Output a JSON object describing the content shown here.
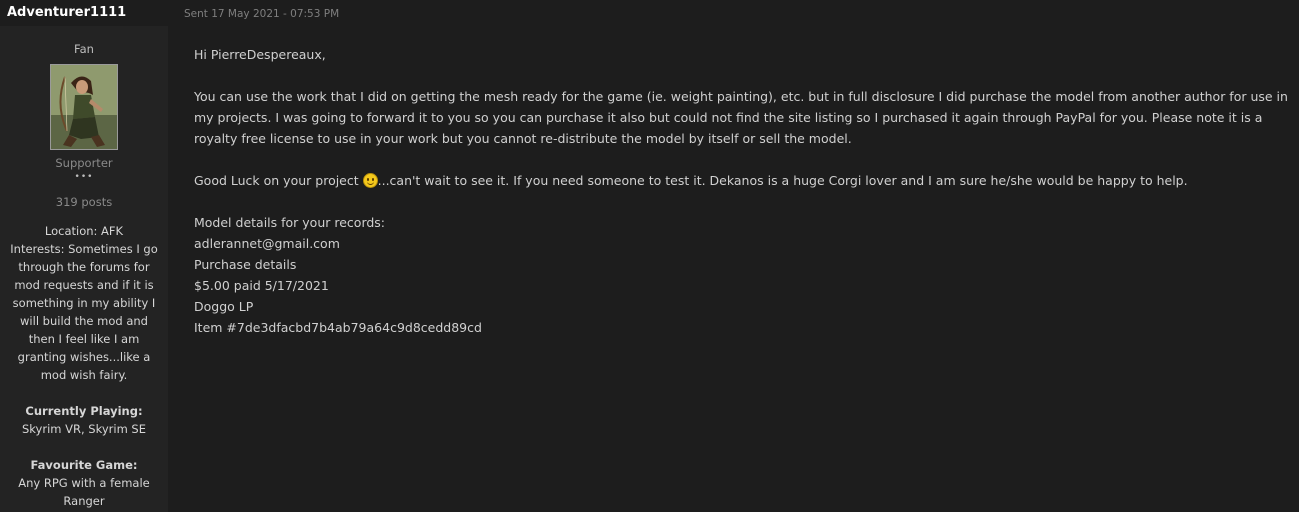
{
  "post": {
    "username": "Adventurer1111",
    "sent": "Sent 17 May 2021 - 07:53 PM"
  },
  "profile": {
    "group": "Fan",
    "rank": "Supporter",
    "rank_dots": "•••",
    "posts": "319 posts",
    "location": "Location: AFK",
    "interests": "Interests: Sometimes I go through the forums for mod requests and if it is something in my ability I will build the mod and then I feel like I am granting wishes...like a mod wish fairy.",
    "currently_playing_label": "Currently Playing:",
    "currently_playing": "Skyrim VR, Skyrim SE",
    "favourite_game_label": "Favourite Game:",
    "favourite_game": "Any RPG with a female Ranger"
  },
  "message": {
    "greeting": "Hi PierreDespereaux,",
    "paragraph1": "You can use the work that I did on getting the mesh ready for the game (ie. weight painting), etc. but in full disclosure I did purchase the model from another author for use in my projects. I was going to forward it to you so you can purchase it also but could not find the site listing so I purchased it again through PayPal for you. Please note it is a royalty free license to use in your work but you cannot re-distribute the model by itself or sell the model.",
    "paragraph2_before": "Good Luck on your project ",
    "paragraph2_after": "...can't wait to see it. If you need someone to test it. Dekanos is a huge Corgi lover and I am sure he/she would be happy to help.",
    "smiley_icon": "smiley-icon",
    "details": [
      "Model details for your records:",
      "adlerannet@gmail.com",
      "Purchase details",
      "$5.00 paid 5/17/2021",
      "Doggo LP",
      "Item #7de3dfacbd7b4ab79a64c9d8cedd89cd"
    ]
  }
}
